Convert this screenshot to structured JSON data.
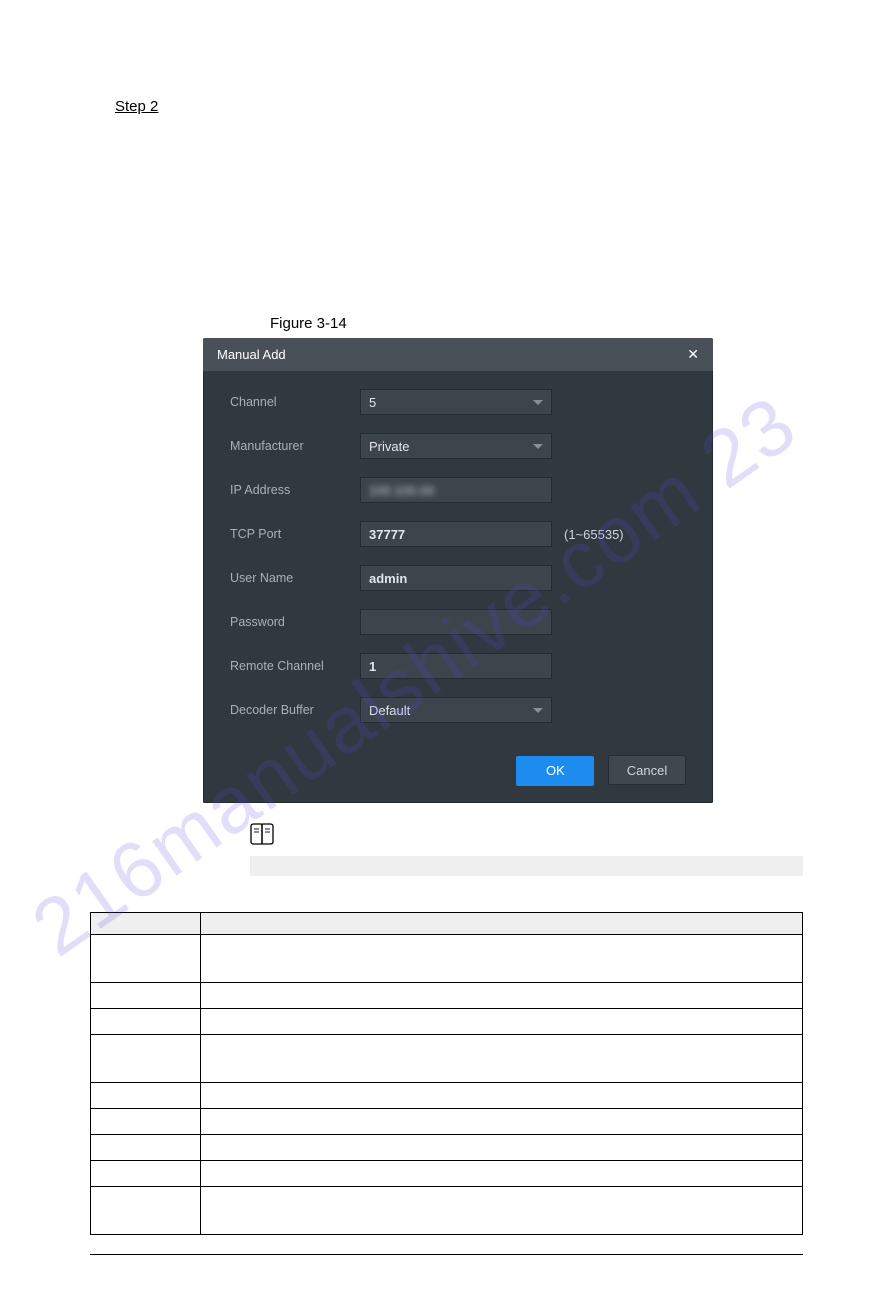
{
  "watermark": "216manualshive.com 23",
  "step_label": "Step 2",
  "figure_label": "Figure 3-14",
  "dialog": {
    "title": "Manual Add",
    "close_glyph": "✕",
    "fields": {
      "channel": {
        "label": "Channel",
        "value": "5"
      },
      "manufacturer": {
        "label": "Manufacturer",
        "value": "Private"
      },
      "ip_address": {
        "label": "IP Address",
        "value_masked": "100.100.00"
      },
      "tcp_port": {
        "label": "TCP Port",
        "value": "37777",
        "hint": "(1~65535)"
      },
      "user_name": {
        "label": "User Name",
        "value": "admin"
      },
      "password": {
        "label": "Password",
        "value": ""
      },
      "remote_channel": {
        "label": "Remote Channel",
        "value": "1"
      },
      "decoder_buffer": {
        "label": "Decoder Buffer",
        "value": "Default"
      }
    },
    "buttons": {
      "ok": "OK",
      "cancel": "Cancel"
    }
  },
  "params_table": {
    "headers": {
      "parameter": "",
      "description": ""
    },
    "rows": [
      {
        "parameter": "",
        "description": "",
        "height": "tall"
      },
      {
        "parameter": "",
        "description": "",
        "height": "short"
      },
      {
        "parameter": "",
        "description": "",
        "height": "short"
      },
      {
        "parameter": "",
        "description": "",
        "height": "tall"
      },
      {
        "parameter": "",
        "description": "",
        "height": "short"
      },
      {
        "parameter": "",
        "description": "",
        "height": "short"
      },
      {
        "parameter": "",
        "description": "",
        "height": "short"
      },
      {
        "parameter": "",
        "description": "",
        "height": "short"
      },
      {
        "parameter": "",
        "description": "",
        "height": "tall"
      }
    ]
  }
}
